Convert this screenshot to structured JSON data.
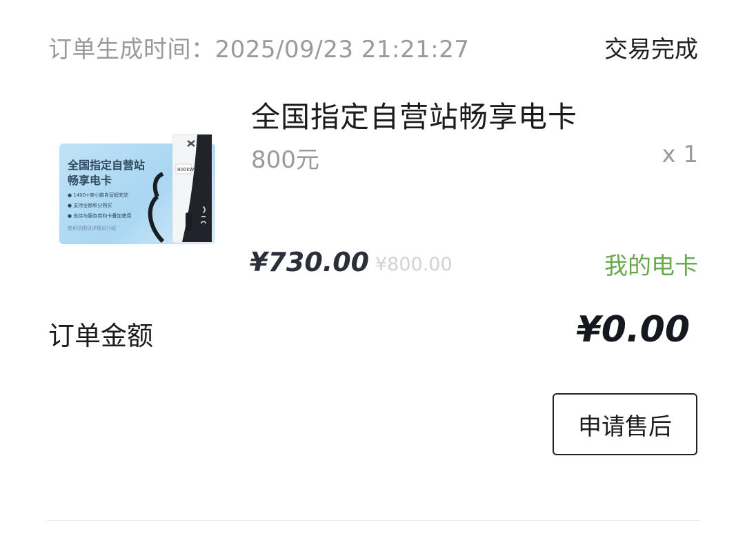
{
  "order": {
    "time_text": "订单生成时间：2025/09/23 21:21:27",
    "status": "交易完成"
  },
  "product": {
    "title": "全国指定自营站畅享电卡",
    "spec": "800元",
    "quantity": "x 1",
    "price": "¥730.00",
    "original_price": "¥800.00",
    "card_link": "我的电卡",
    "thumbnail": {
      "title_line1": "全国指定自营站",
      "title_line2": "畅享电卡",
      "bullets": [
        "1400+座小鹏自营超充站",
        "支持全额积分购买",
        "支持与服务券和卡叠加使用"
      ],
      "footnote": "使用范围见详情页介绍",
      "device_label": "800kW"
    }
  },
  "summary": {
    "label": "订单金额",
    "amount": "¥0.00"
  },
  "actions": {
    "after_sale_label": "申请售后"
  },
  "colors": {
    "accent_green": "#6aa84f",
    "muted_gray": "#9a9a9a"
  }
}
